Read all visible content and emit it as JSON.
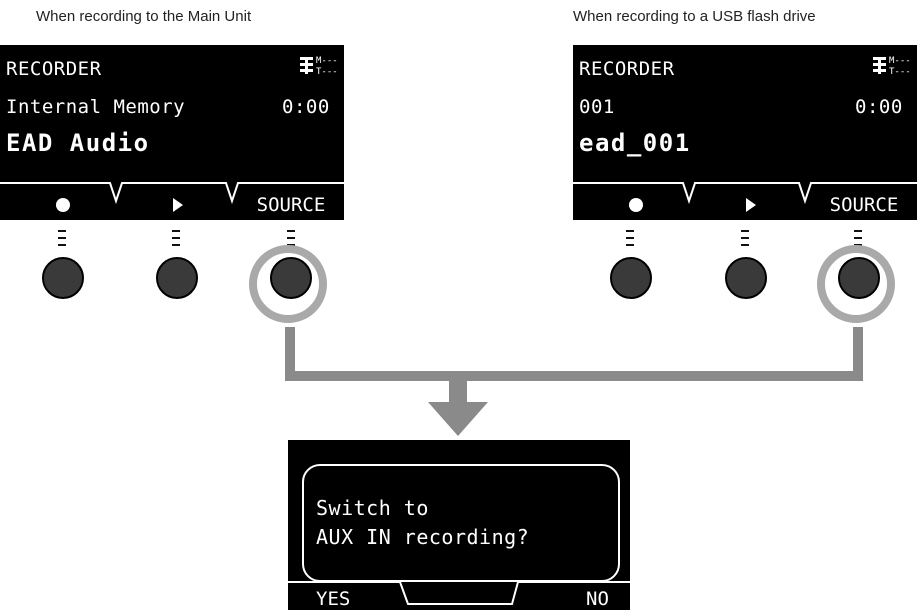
{
  "captions": {
    "left": "When recording to the Main Unit",
    "right": "When recording to a USB flash drive"
  },
  "left_screen": {
    "title": "RECORDER",
    "status_icon": "drum-metronome-status-icon",
    "location": "Internal Memory",
    "time": "0:00",
    "name": "EAD Audio",
    "softkeys": [
      "record-dot-icon",
      "play-triangle-icon",
      "SOURCE"
    ]
  },
  "right_screen": {
    "title": "RECORDER",
    "status_icon": "drum-metronome-status-icon",
    "location": "001",
    "time": "0:00",
    "name": "ead_001",
    "softkeys": [
      "record-dot-icon",
      "play-triangle-icon",
      "SOURCE"
    ]
  },
  "dialog": {
    "line1": "Switch to",
    "line2": "AUX IN recording?",
    "yes": "YES",
    "no": "NO"
  },
  "colors": {
    "screen": "#000000",
    "highlight_ring": "#a9a9a9",
    "arrow": "#8a8a8a",
    "knob": "#3a3a3a"
  }
}
